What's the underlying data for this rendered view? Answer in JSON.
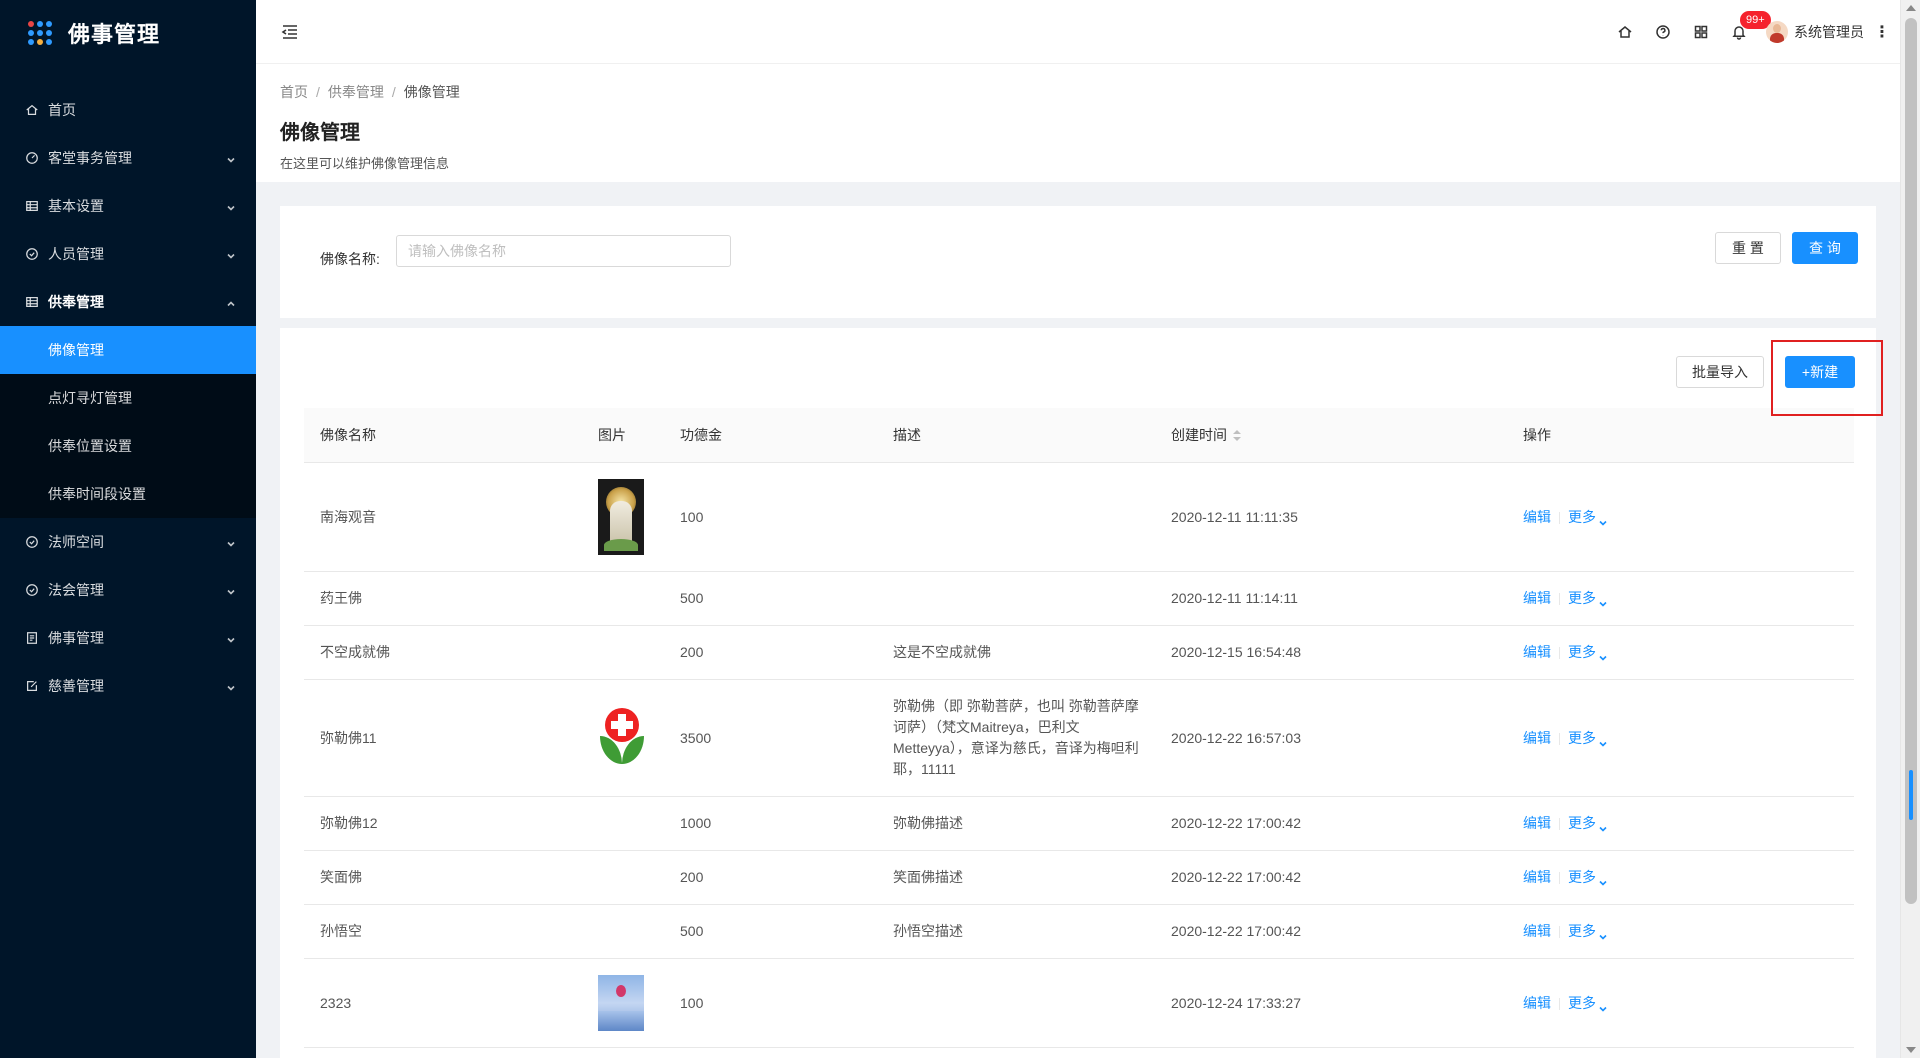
{
  "brand": {
    "title": "佛事管理",
    "dot_colors": [
      "#e84545",
      "#2f9bff",
      "#2f9bff",
      "#2f9bff",
      "#2f9bff",
      "#2f9bff",
      "#2f9bff",
      "#f5b041",
      "#2f9bff"
    ]
  },
  "sidebar": {
    "items": [
      {
        "label": "首页",
        "icon": "home-icon",
        "has_caret": false
      },
      {
        "label": "客堂事务管理",
        "icon": "dashboard-icon",
        "has_caret": true
      },
      {
        "label": "基本设置",
        "icon": "table-icon",
        "has_caret": true
      },
      {
        "label": "人员管理",
        "icon": "check-circle-icon",
        "has_caret": true
      },
      {
        "label": "供奉管理",
        "icon": "table-icon",
        "has_caret": true,
        "open": true
      }
    ],
    "sub_items": [
      {
        "label": "佛像管理",
        "active": true
      },
      {
        "label": "点灯寻灯管理",
        "active": false
      },
      {
        "label": "供奉位置设置",
        "active": false
      },
      {
        "label": "供奉时间段设置",
        "active": false
      }
    ],
    "items_after": [
      {
        "label": "法师空间",
        "icon": "check-circle-icon",
        "has_caret": true
      },
      {
        "label": "法会管理",
        "icon": "check-circle-icon",
        "has_caret": true
      },
      {
        "label": "佛事管理",
        "icon": "profile-icon",
        "has_caret": true
      },
      {
        "label": "慈善管理",
        "icon": "form-icon",
        "has_caret": true
      }
    ]
  },
  "header": {
    "notification_count": "99+",
    "username": "系统管理员"
  },
  "breadcrumb": {
    "home": "首页",
    "parent": "供奉管理",
    "current": "佛像管理"
  },
  "page": {
    "title": "佛像管理",
    "description": "在这里可以维护佛像管理信息"
  },
  "search": {
    "label": "佛像名称:",
    "placeholder": "请输入佛像名称",
    "value": "",
    "reset_label": "重 置",
    "query_label": "查 询"
  },
  "toolbar": {
    "import_label": "批量导入",
    "new_label": "+新建"
  },
  "table": {
    "headers": [
      "佛像名称",
      "图片",
      "功德金",
      "描述",
      "创建时间",
      "操作"
    ],
    "edit_label": "编辑",
    "more_label": "更多",
    "rows": [
      {
        "name": "南海观音",
        "image": "guanyin",
        "amount": "100",
        "desc": "",
        "created": "2020-12-11 11:11:35"
      },
      {
        "name": "药王佛",
        "image": "",
        "amount": "500",
        "desc": "",
        "created": "2020-12-11 11:14:11"
      },
      {
        "name": "不空成就佛",
        "image": "",
        "amount": "200",
        "desc": "这是不空成就佛",
        "created": "2020-12-15 16:54:48"
      },
      {
        "name": "弥勒佛11",
        "image": "cross",
        "amount": "3500",
        "desc": "弥勒佛（即 弥勒菩萨，也叫 弥勒菩萨摩诃萨）（梵文Maitreya，巴利文Metteyya），意译为慈氏，音译为梅呾利耶，11111",
        "created": "2020-12-22 16:57:03"
      },
      {
        "name": "弥勒佛12",
        "image": "",
        "amount": "1000",
        "desc": "弥勒佛描述",
        "created": "2020-12-22 17:00:42"
      },
      {
        "name": "笑面佛",
        "image": "",
        "amount": "200",
        "desc": "笑面佛描述",
        "created": "2020-12-22 17:00:42"
      },
      {
        "name": "孙悟空",
        "image": "",
        "amount": "500",
        "desc": "孙悟空描述",
        "created": "2020-12-22 17:00:42"
      },
      {
        "name": "2323",
        "image": "sky",
        "amount": "100",
        "desc": "",
        "created": "2020-12-24 17:33:27"
      }
    ]
  },
  "colors": {
    "primary": "#1890ff",
    "sidebar_bg": "#001529",
    "highlight": "#e02020"
  }
}
